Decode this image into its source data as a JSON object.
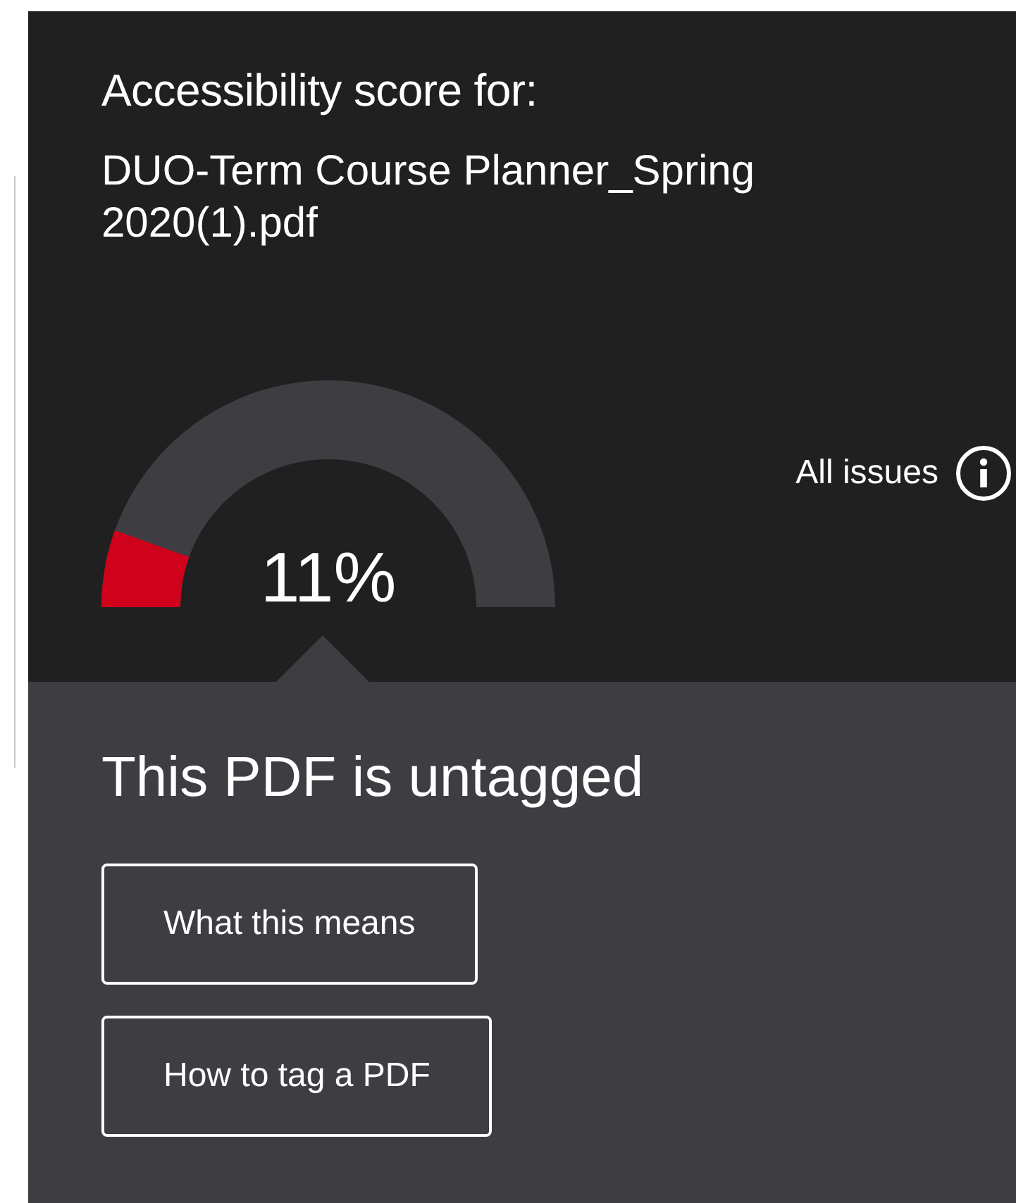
{
  "header": {
    "label": "Accessibility score for:",
    "file_name": "DUO-Term Course Planner_Spring 2020(1).pdf"
  },
  "gauge": {
    "level": 0.11,
    "reading": "11%"
  },
  "all_issues": {
    "label": "All issues"
  },
  "result": {
    "heading": "This PDF is untagged"
  },
  "buttons": [
    "What this means",
    "How to tag a PDF"
  ]
}
